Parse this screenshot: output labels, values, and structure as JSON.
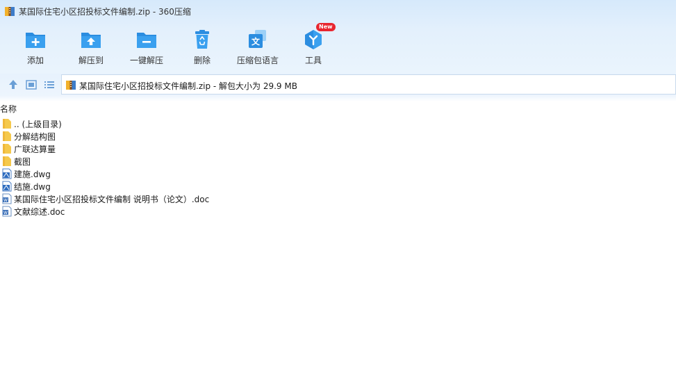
{
  "window": {
    "title": "某国际住宅小区招投标文件编制.zip - 360压缩"
  },
  "toolbar": {
    "items": [
      {
        "label": "添加",
        "icon": "add-icon"
      },
      {
        "label": "解压到",
        "icon": "extract-to-icon"
      },
      {
        "label": "一键解压",
        "icon": "one-click-extract-icon"
      },
      {
        "label": "删除",
        "icon": "delete-icon"
      },
      {
        "label": "压缩包语言",
        "icon": "archive-language-icon"
      },
      {
        "label": "工具",
        "icon": "tools-icon",
        "badge": "New"
      }
    ]
  },
  "address": {
    "text": "某国际住宅小区招投标文件编制.zip - 解包大小为 29.9 MB"
  },
  "list": {
    "column_name": "名称",
    "files": [
      {
        "name": ".. (上级目录)",
        "type": "folder"
      },
      {
        "name": "分解结构图",
        "type": "folder"
      },
      {
        "name": "广联达算量",
        "type": "folder"
      },
      {
        "name": "截图",
        "type": "folder"
      },
      {
        "name": "建施.dwg",
        "type": "dwg"
      },
      {
        "name": "结施.dwg",
        "type": "dwg"
      },
      {
        "name": "某国际住宅小区招投标文件编制 说明书（论文）.doc",
        "type": "doc"
      },
      {
        "name": "文献综述.doc",
        "type": "doc"
      }
    ]
  },
  "colors": {
    "accent": "#2b8de0",
    "folder": "#f5c94c",
    "badge": "#e8262f"
  }
}
